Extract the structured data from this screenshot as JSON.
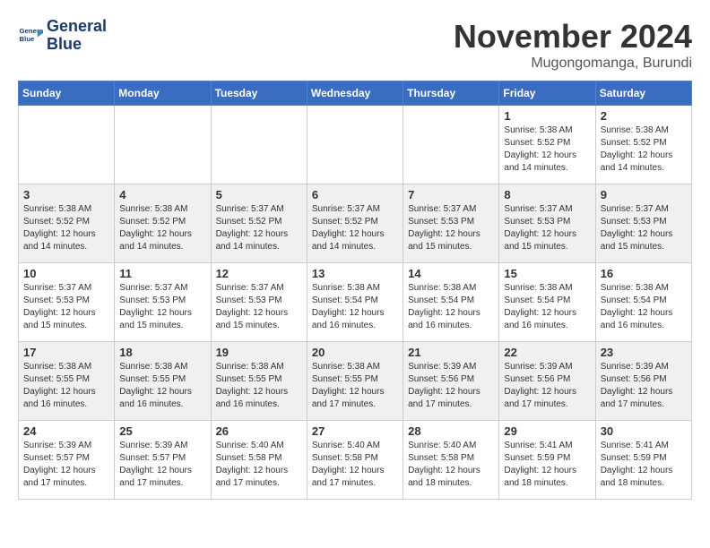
{
  "logo": {
    "line1": "General",
    "line2": "Blue"
  },
  "title": "November 2024",
  "subtitle": "Mugongomanga, Burundi",
  "weekdays": [
    "Sunday",
    "Monday",
    "Tuesday",
    "Wednesday",
    "Thursday",
    "Friday",
    "Saturday"
  ],
  "weeks": [
    [
      {
        "day": "",
        "text": ""
      },
      {
        "day": "",
        "text": ""
      },
      {
        "day": "",
        "text": ""
      },
      {
        "day": "",
        "text": ""
      },
      {
        "day": "",
        "text": ""
      },
      {
        "day": "1",
        "text": "Sunrise: 5:38 AM\nSunset: 5:52 PM\nDaylight: 12 hours and 14 minutes."
      },
      {
        "day": "2",
        "text": "Sunrise: 5:38 AM\nSunset: 5:52 PM\nDaylight: 12 hours and 14 minutes."
      }
    ],
    [
      {
        "day": "3",
        "text": "Sunrise: 5:38 AM\nSunset: 5:52 PM\nDaylight: 12 hours and 14 minutes."
      },
      {
        "day": "4",
        "text": "Sunrise: 5:38 AM\nSunset: 5:52 PM\nDaylight: 12 hours and 14 minutes."
      },
      {
        "day": "5",
        "text": "Sunrise: 5:37 AM\nSunset: 5:52 PM\nDaylight: 12 hours and 14 minutes."
      },
      {
        "day": "6",
        "text": "Sunrise: 5:37 AM\nSunset: 5:52 PM\nDaylight: 12 hours and 14 minutes."
      },
      {
        "day": "7",
        "text": "Sunrise: 5:37 AM\nSunset: 5:53 PM\nDaylight: 12 hours and 15 minutes."
      },
      {
        "day": "8",
        "text": "Sunrise: 5:37 AM\nSunset: 5:53 PM\nDaylight: 12 hours and 15 minutes."
      },
      {
        "day": "9",
        "text": "Sunrise: 5:37 AM\nSunset: 5:53 PM\nDaylight: 12 hours and 15 minutes."
      }
    ],
    [
      {
        "day": "10",
        "text": "Sunrise: 5:37 AM\nSunset: 5:53 PM\nDaylight: 12 hours and 15 minutes."
      },
      {
        "day": "11",
        "text": "Sunrise: 5:37 AM\nSunset: 5:53 PM\nDaylight: 12 hours and 15 minutes."
      },
      {
        "day": "12",
        "text": "Sunrise: 5:37 AM\nSunset: 5:53 PM\nDaylight: 12 hours and 15 minutes."
      },
      {
        "day": "13",
        "text": "Sunrise: 5:38 AM\nSunset: 5:54 PM\nDaylight: 12 hours and 16 minutes."
      },
      {
        "day": "14",
        "text": "Sunrise: 5:38 AM\nSunset: 5:54 PM\nDaylight: 12 hours and 16 minutes."
      },
      {
        "day": "15",
        "text": "Sunrise: 5:38 AM\nSunset: 5:54 PM\nDaylight: 12 hours and 16 minutes."
      },
      {
        "day": "16",
        "text": "Sunrise: 5:38 AM\nSunset: 5:54 PM\nDaylight: 12 hours and 16 minutes."
      }
    ],
    [
      {
        "day": "17",
        "text": "Sunrise: 5:38 AM\nSunset: 5:55 PM\nDaylight: 12 hours and 16 minutes."
      },
      {
        "day": "18",
        "text": "Sunrise: 5:38 AM\nSunset: 5:55 PM\nDaylight: 12 hours and 16 minutes."
      },
      {
        "day": "19",
        "text": "Sunrise: 5:38 AM\nSunset: 5:55 PM\nDaylight: 12 hours and 16 minutes."
      },
      {
        "day": "20",
        "text": "Sunrise: 5:38 AM\nSunset: 5:55 PM\nDaylight: 12 hours and 17 minutes."
      },
      {
        "day": "21",
        "text": "Sunrise: 5:39 AM\nSunset: 5:56 PM\nDaylight: 12 hours and 17 minutes."
      },
      {
        "day": "22",
        "text": "Sunrise: 5:39 AM\nSunset: 5:56 PM\nDaylight: 12 hours and 17 minutes."
      },
      {
        "day": "23",
        "text": "Sunrise: 5:39 AM\nSunset: 5:56 PM\nDaylight: 12 hours and 17 minutes."
      }
    ],
    [
      {
        "day": "24",
        "text": "Sunrise: 5:39 AM\nSunset: 5:57 PM\nDaylight: 12 hours and 17 minutes."
      },
      {
        "day": "25",
        "text": "Sunrise: 5:39 AM\nSunset: 5:57 PM\nDaylight: 12 hours and 17 minutes."
      },
      {
        "day": "26",
        "text": "Sunrise: 5:40 AM\nSunset: 5:58 PM\nDaylight: 12 hours and 17 minutes."
      },
      {
        "day": "27",
        "text": "Sunrise: 5:40 AM\nSunset: 5:58 PM\nDaylight: 12 hours and 17 minutes."
      },
      {
        "day": "28",
        "text": "Sunrise: 5:40 AM\nSunset: 5:58 PM\nDaylight: 12 hours and 18 minutes."
      },
      {
        "day": "29",
        "text": "Sunrise: 5:41 AM\nSunset: 5:59 PM\nDaylight: 12 hours and 18 minutes."
      },
      {
        "day": "30",
        "text": "Sunrise: 5:41 AM\nSunset: 5:59 PM\nDaylight: 12 hours and 18 minutes."
      }
    ]
  ]
}
